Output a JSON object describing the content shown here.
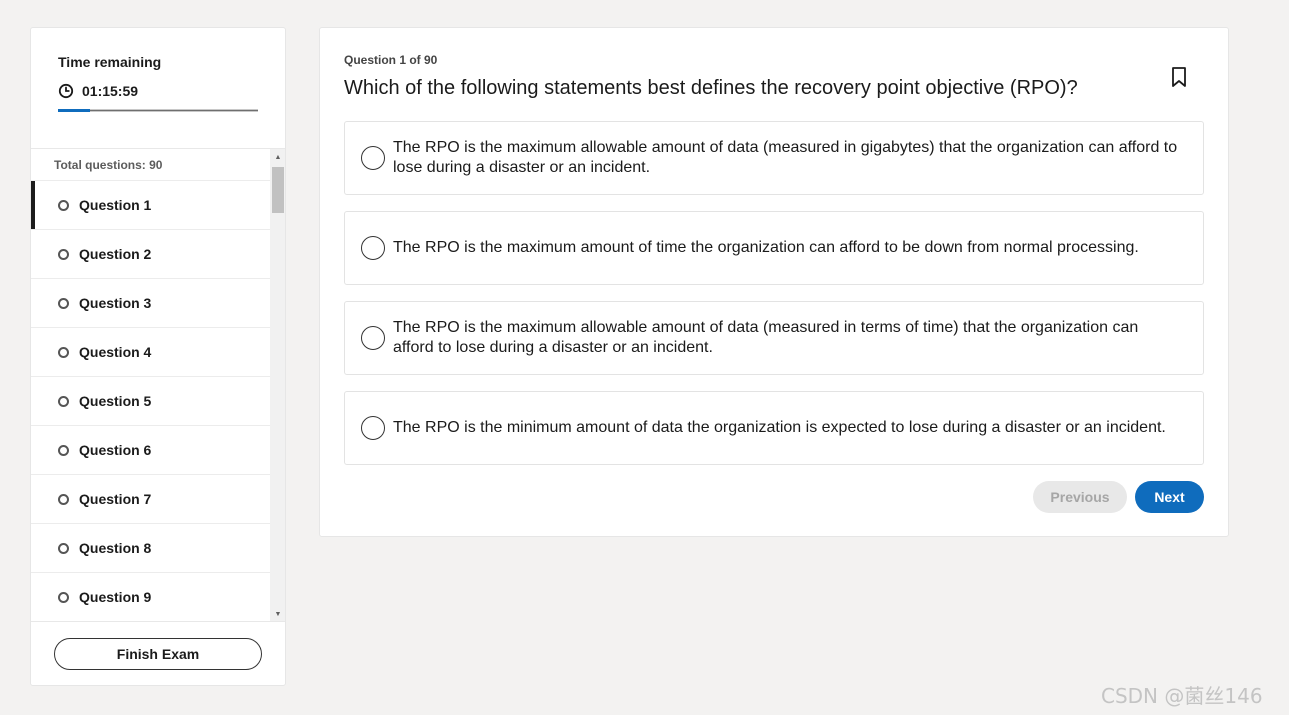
{
  "timer": {
    "title": "Time remaining",
    "value": "01:15:59",
    "progress_fraction": 0.16,
    "icon": "clock-icon"
  },
  "question_list": {
    "total_label": "Total questions: 90",
    "items": [
      {
        "label": "Question 1",
        "active": true
      },
      {
        "label": "Question 2",
        "active": false
      },
      {
        "label": "Question 3",
        "active": false
      },
      {
        "label": "Question 4",
        "active": false
      },
      {
        "label": "Question 5",
        "active": false
      },
      {
        "label": "Question 6",
        "active": false
      },
      {
        "label": "Question 7",
        "active": false
      },
      {
        "label": "Question 8",
        "active": false
      },
      {
        "label": "Question 9",
        "active": false
      }
    ]
  },
  "finish_label": "Finish Exam",
  "question": {
    "counter": "Question 1 of 90",
    "text": "Which of the following statements best defines the recovery point objective (RPO)?",
    "options": [
      "The RPO is the maximum allowable amount of data (measured in gigabytes) that the organization can afford to lose during a disaster or an incident.",
      "The RPO is the maximum amount of time the organization can afford to be down from normal processing.",
      "The RPO is the maximum allowable amount of data (measured in terms of time) that the organization can afford to lose during a disaster or an incident.",
      "The RPO is the minimum amount of data the organization is expected to lose during a disaster or an incident."
    ]
  },
  "nav": {
    "previous_label": "Previous",
    "next_label": "Next"
  },
  "watermark": "CSDN @菌丝146",
  "colors": {
    "accent": "#0f6cbd",
    "background": "#f3f2f1",
    "disabled": "#e8e8e8"
  }
}
